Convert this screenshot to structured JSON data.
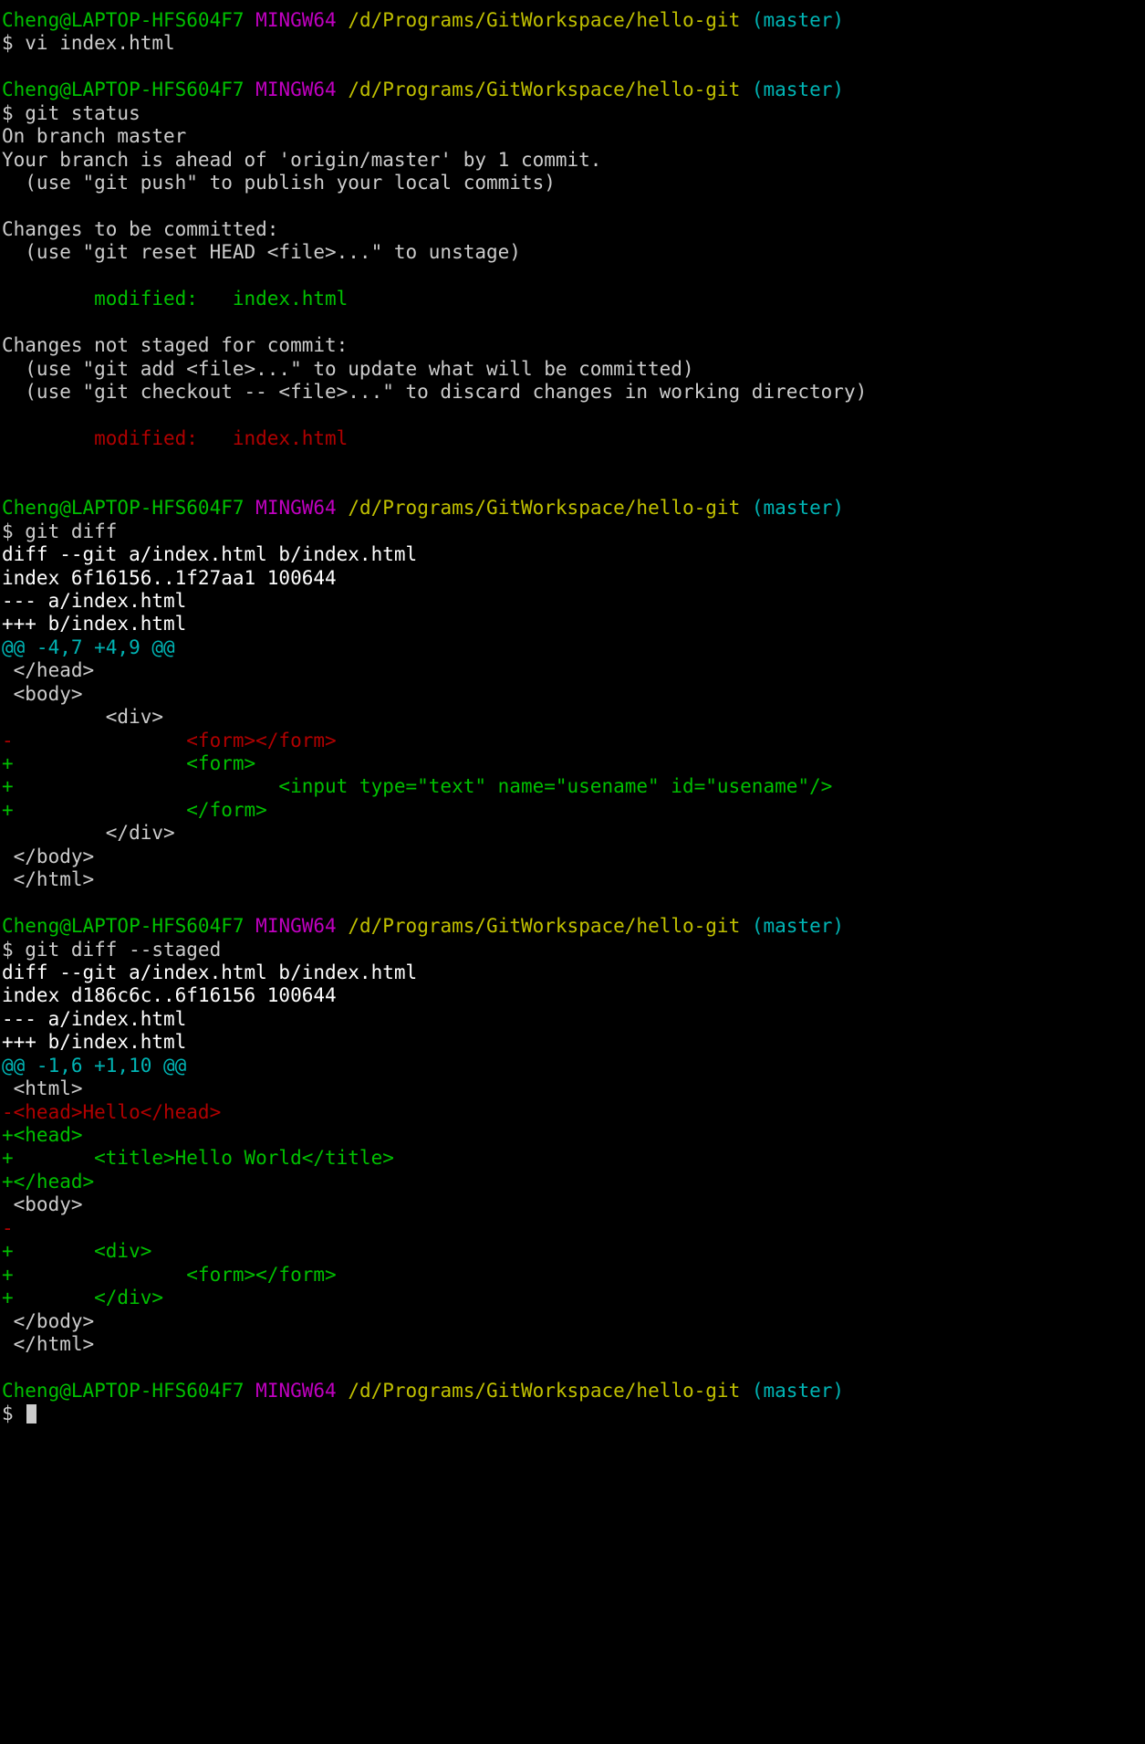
{
  "terminal": {
    "shell": "MINGW64",
    "title": "MINGW64:/d/Programs/GitWorkspace/hello-git",
    "background_color": "#000000",
    "foreground_color": "#cccccc",
    "colors": {
      "user_host": "#00c000",
      "shell_tag": "#c000c0",
      "path": "#c0c000",
      "branch": "#00b4b4",
      "diff_add": "#00c000",
      "diff_remove": "#b00000",
      "diff_hunk": "#00b4b4",
      "diff_header": "#ffffff"
    },
    "prompt": {
      "user_host": "Cheng@LAPTOP-HFS604F7",
      "shell_tag": "MINGW64",
      "path": "/d/Programs/GitWorkspace/hello-git",
      "branch": "(master)",
      "symbol": "$"
    }
  },
  "lines": [
    {
      "id": "prompt-1",
      "type": "prompt"
    },
    {
      "id": "cmd-1",
      "type": "command",
      "text": "$ vi index.html"
    },
    {
      "id": "blank-1",
      "type": "blank",
      "text": ""
    },
    {
      "id": "prompt-2",
      "type": "prompt"
    },
    {
      "id": "cmd-2",
      "type": "command",
      "text": "$ git status"
    },
    {
      "id": "out-1",
      "type": "plain",
      "text": "On branch master"
    },
    {
      "id": "out-2",
      "type": "plain",
      "text": "Your branch is ahead of 'origin/master' by 1 commit."
    },
    {
      "id": "out-3",
      "type": "plain",
      "text": "  (use \"git push\" to publish your local commits)"
    },
    {
      "id": "blank-2",
      "type": "blank",
      "text": ""
    },
    {
      "id": "out-4",
      "type": "plain",
      "text": "Changes to be committed:"
    },
    {
      "id": "out-5",
      "type": "plain",
      "text": "  (use \"git reset HEAD <file>...\" to unstage)"
    },
    {
      "id": "blank-3",
      "type": "blank",
      "text": ""
    },
    {
      "id": "out-6",
      "type": "green",
      "text": "        modified:   index.html"
    },
    {
      "id": "blank-4",
      "type": "blank",
      "text": ""
    },
    {
      "id": "out-7",
      "type": "plain",
      "text": "Changes not staged for commit:"
    },
    {
      "id": "out-8",
      "type": "plain",
      "text": "  (use \"git add <file>...\" to update what will be committed)"
    },
    {
      "id": "out-9",
      "type": "plain",
      "text": "  (use \"git checkout -- <file>...\" to discard changes in working directory)"
    },
    {
      "id": "blank-5",
      "type": "blank",
      "text": ""
    },
    {
      "id": "out-10",
      "type": "red",
      "text": "        modified:   index.html"
    },
    {
      "id": "blank-6",
      "type": "blank",
      "text": ""
    },
    {
      "id": "blank-7",
      "type": "blank",
      "text": ""
    },
    {
      "id": "prompt-3",
      "type": "prompt"
    },
    {
      "id": "cmd-3",
      "type": "command",
      "text": "$ git diff"
    },
    {
      "id": "d1-1",
      "type": "bwhite",
      "text": "diff --git a/index.html b/index.html"
    },
    {
      "id": "d1-2",
      "type": "bwhite",
      "text": "index 6f16156..1f27aa1 100644"
    },
    {
      "id": "d1-3",
      "type": "bwhite",
      "text": "--- a/index.html"
    },
    {
      "id": "d1-4",
      "type": "bwhite",
      "text": "+++ b/index.html"
    },
    {
      "id": "d1-5",
      "type": "cyan",
      "text": "@@ -4,7 +4,9 @@"
    },
    {
      "id": "d1-6",
      "type": "plain",
      "text": " </head>"
    },
    {
      "id": "d1-7",
      "type": "plain",
      "text": " <body>"
    },
    {
      "id": "d1-8",
      "type": "plain",
      "text": "         <div>"
    },
    {
      "id": "d1-9",
      "type": "red",
      "text": "-               <form></form>"
    },
    {
      "id": "d1-10",
      "type": "green",
      "text": "+               <form>"
    },
    {
      "id": "d1-11",
      "type": "green",
      "text": "+                       <input type=\"text\" name=\"usename\" id=\"usename\"/>"
    },
    {
      "id": "d1-12",
      "type": "green",
      "text": "+               </form>"
    },
    {
      "id": "d1-13",
      "type": "plain",
      "text": "         </div>"
    },
    {
      "id": "d1-14",
      "type": "plain",
      "text": " </body>"
    },
    {
      "id": "d1-15",
      "type": "plain",
      "text": " </html>"
    },
    {
      "id": "blank-8",
      "type": "blank",
      "text": ""
    },
    {
      "id": "prompt-4",
      "type": "prompt"
    },
    {
      "id": "cmd-4",
      "type": "command",
      "text": "$ git diff --staged"
    },
    {
      "id": "d2-1",
      "type": "bwhite",
      "text": "diff --git a/index.html b/index.html"
    },
    {
      "id": "d2-2",
      "type": "bwhite",
      "text": "index d186c6c..6f16156 100644"
    },
    {
      "id": "d2-3",
      "type": "bwhite",
      "text": "--- a/index.html"
    },
    {
      "id": "d2-4",
      "type": "bwhite",
      "text": "+++ b/index.html"
    },
    {
      "id": "d2-5",
      "type": "cyan",
      "text": "@@ -1,6 +1,10 @@"
    },
    {
      "id": "d2-6",
      "type": "plain",
      "text": " <html>"
    },
    {
      "id": "d2-7",
      "type": "red",
      "text": "-<head>Hello</head>"
    },
    {
      "id": "d2-8",
      "type": "green",
      "text": "+<head>"
    },
    {
      "id": "d2-9",
      "type": "green",
      "text": "+       <title>Hello World</title>"
    },
    {
      "id": "d2-10",
      "type": "green",
      "text": "+</head>"
    },
    {
      "id": "d2-11",
      "type": "plain",
      "text": " <body>"
    },
    {
      "id": "d2-12",
      "type": "red",
      "text": "-"
    },
    {
      "id": "d2-13",
      "type": "green",
      "text": "+       <div>"
    },
    {
      "id": "d2-14",
      "type": "green",
      "text": "+               <form></form>"
    },
    {
      "id": "d2-15",
      "type": "green",
      "text": "+       </div>"
    },
    {
      "id": "d2-16",
      "type": "plain",
      "text": " </body>"
    },
    {
      "id": "d2-17",
      "type": "plain",
      "text": " </html>"
    },
    {
      "id": "blank-9",
      "type": "blank",
      "text": ""
    },
    {
      "id": "prompt-5",
      "type": "prompt"
    },
    {
      "id": "cmd-5",
      "type": "command",
      "text": "$ ",
      "cursor": true
    }
  ]
}
